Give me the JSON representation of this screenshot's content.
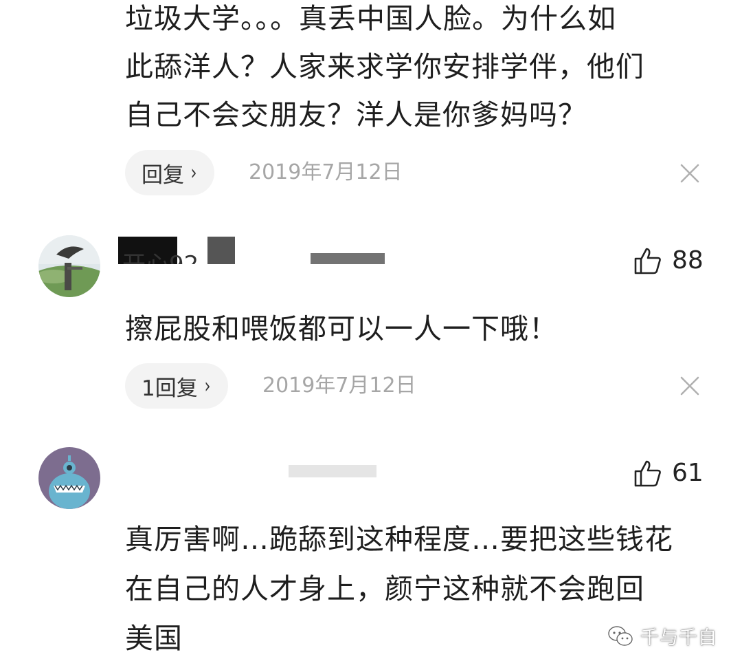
{
  "comments": [
    {
      "lines": [
        "垃圾大学。。。真丢中国人脸。为什么如",
        "此舔洋人？人家来求学你安排学伴，他们",
        "自己不会交朋友？洋人是你爹妈吗？"
      ],
      "reply_label": "回复",
      "date": "2019年7月12日"
    },
    {
      "username": "开心92",
      "likes": "88",
      "lines": [
        "擦屁股和喂饭都可以一人一下哦！"
      ],
      "reply_label": "1回复",
      "date": "2019年7月12日"
    },
    {
      "username": "",
      "likes": "61",
      "lines": [
        "真厉害啊…跪舔到这种程度…要把这些钱花",
        "在自己的人才身上，颜宁这种就不会跑回",
        "美国"
      ]
    }
  ],
  "icons": {
    "reply_chevron": "chevron-right-icon",
    "close": "close-icon",
    "like": "thumbs-up-icon",
    "watermark": "wechat-icon"
  },
  "watermark": {
    "text": "千与千自"
  },
  "colors": {
    "text": "#1e1e1e",
    "meta": "#a6a6a6",
    "chip_bg": "#f3f3f3",
    "close": "#b0b0b0"
  }
}
